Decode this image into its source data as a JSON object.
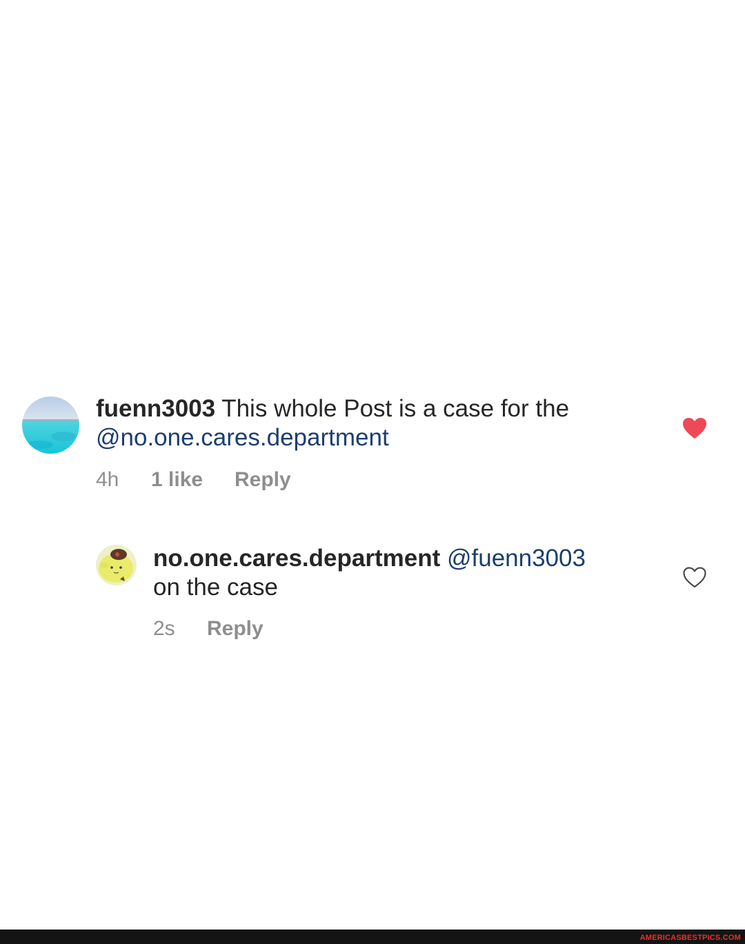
{
  "comments": [
    {
      "username": "fuenn3003",
      "text": " This whole Post is a case for the ",
      "mention": "@no.one.cares.department",
      "time": "4h",
      "likes": "1 like",
      "reply_label": "Reply",
      "liked": true,
      "avatar_icon": "ocean-photo-avatar"
    },
    {
      "username": "no.one.cares.department",
      "mention": "@fuenn3003",
      "text": "on the case",
      "time": "2s",
      "reply_label": "Reply",
      "liked": false,
      "avatar_icon": "cartoon-character-avatar"
    }
  ],
  "colors": {
    "liked_heart": "#ed4956",
    "mention": "#1c3e6e",
    "meta_text": "#8e8e8e"
  },
  "watermark": "AMERICASBESTPICS.COM"
}
